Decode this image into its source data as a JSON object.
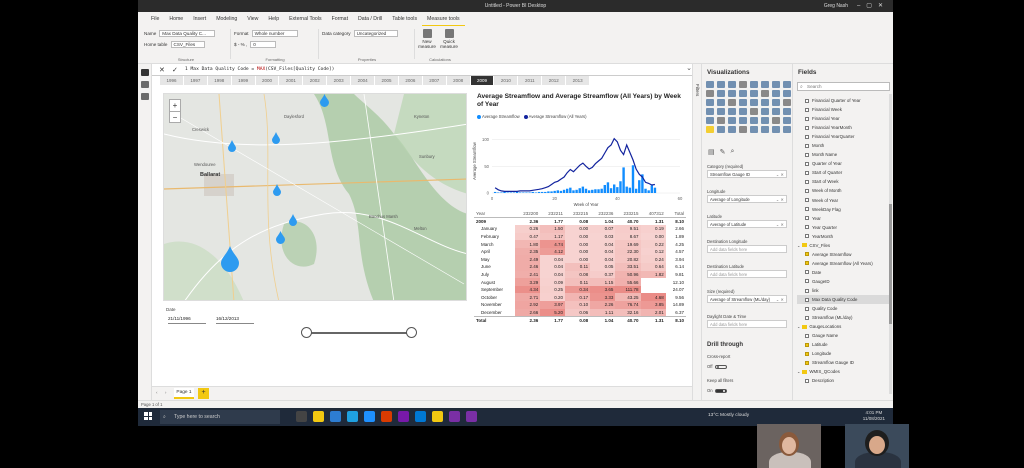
{
  "window": {
    "title": "Untitled - Power BI Desktop",
    "user": "Greg Nash"
  },
  "menu": [
    "File",
    "Home",
    "Insert",
    "Modeling",
    "View",
    "Help",
    "External Tools",
    "Format",
    "Data / Drill",
    "Table tools",
    "Measure tools"
  ],
  "menu_active": "Measure tools",
  "ribbon": {
    "name_label": "Name",
    "name_value": "Max Data Quality C...",
    "home_table_label": "Home table",
    "home_table_value": "CSV_Files",
    "structure_caption": "Structure",
    "format_label": "Format",
    "format_value": "Whole number",
    "format_symbols": "$ - % ,",
    "decimals_value": "0",
    "formatting_caption": "Formatting",
    "data_category_label": "Data category",
    "data_category_value": "Uncategorized",
    "properties_caption": "Properties",
    "new_measure_label": "New measure",
    "quick_measure_label": "Quick measure",
    "calculations_caption": "Calculations"
  },
  "formula": {
    "prefix": "1 Max Data Quality Code = ",
    "func": "MAX",
    "rest": "(CSV_Files[Quality Code])"
  },
  "years": [
    "1996",
    "1997",
    "1998",
    "1999",
    "2000",
    "2001",
    "2002",
    "2003",
    "2004",
    "2005",
    "2006",
    "2007",
    "2008",
    "2009",
    "2010",
    "2011",
    "2012",
    "2013"
  ],
  "year_selected": "2009",
  "map": {
    "labels": [
      {
        "text": "Ballarat",
        "big": true
      },
      {
        "text": "Wendouree"
      },
      {
        "text": "Creswick"
      },
      {
        "text": "Bacchus Marsh"
      },
      {
        "text": "Melton"
      },
      {
        "text": "Sunbury"
      },
      {
        "text": "Daylesford"
      },
      {
        "text": "Kyneton"
      }
    ]
  },
  "date_slicer": {
    "label": "Date",
    "from": "21/11/1996",
    "to": "16/12/2013"
  },
  "chart": {
    "title": "Average Streamflow and Average Streamflow (All Years) by Week of Year",
    "legend": [
      "Average Streamflow",
      "Average Streamflow (All Years)"
    ],
    "ylabel": "Average Streamflow",
    "xlabel": "Week of Year",
    "y_ticks": [
      "100",
      "50",
      "0"
    ],
    "x_ticks": [
      "0",
      "20",
      "40",
      "60"
    ]
  },
  "chart_data": {
    "type": "line",
    "title": "Average Streamflow and Average Streamflow (All Years) by Week of Year",
    "xlabel": "Week of Year",
    "ylabel": "Average Streamflow",
    "xlim": [
      0,
      60
    ],
    "ylim": [
      0,
      120
    ],
    "series": [
      {
        "name": "Average Streamflow",
        "kind": "bar",
        "color": "#118dff",
        "x": [
          1,
          2,
          3,
          4,
          5,
          6,
          7,
          8,
          9,
          10,
          11,
          12,
          13,
          14,
          15,
          16,
          17,
          18,
          19,
          20,
          21,
          22,
          23,
          24,
          25,
          26,
          27,
          28,
          29,
          30,
          31,
          32,
          33,
          34,
          35,
          36,
          37,
          38,
          39,
          40,
          41,
          42,
          43,
          44,
          45,
          46,
          47,
          48,
          49,
          50,
          51,
          52
        ],
        "y": [
          2,
          1,
          1,
          2,
          1,
          1,
          1,
          2,
          1,
          1,
          1,
          1,
          2,
          1,
          2,
          2,
          2,
          3,
          3,
          4,
          5,
          4,
          6,
          8,
          10,
          5,
          6,
          9,
          12,
          8,
          5,
          6,
          7,
          7,
          8,
          15,
          20,
          9,
          16,
          11,
          22,
          48,
          12,
          10,
          52,
          8,
          24,
          35,
          8,
          5,
          14,
          10
        ]
      },
      {
        "name": "Average Streamflow (All Years)",
        "kind": "line",
        "color": "#12239e",
        "x": [
          1,
          2,
          3,
          4,
          5,
          6,
          7,
          8,
          9,
          10,
          11,
          12,
          13,
          14,
          15,
          16,
          17,
          18,
          19,
          20,
          21,
          22,
          23,
          24,
          25,
          26,
          27,
          28,
          29,
          30,
          31,
          32,
          33,
          34,
          35,
          36,
          37,
          38,
          39,
          40,
          41,
          42,
          43,
          44,
          45,
          46,
          47,
          48,
          49,
          50,
          51,
          52
        ],
        "y": [
          10,
          6,
          4,
          3,
          3,
          3,
          3,
          3,
          4,
          4,
          4,
          4,
          5,
          6,
          7,
          8,
          10,
          12,
          16,
          20,
          22,
          26,
          30,
          38,
          44,
          40,
          46,
          52,
          56,
          50,
          45,
          48,
          55,
          60,
          65,
          75,
          85,
          90,
          102,
          96,
          80,
          72,
          90,
          76,
          62,
          45,
          35,
          30,
          20,
          18,
          15,
          16
        ]
      }
    ]
  },
  "matrix": {
    "columns": [
      "Year",
      "232200",
      "232211",
      "232215",
      "232236",
      "233215",
      "407312",
      "Total"
    ],
    "year_row": {
      "label": "2009",
      "values": [
        "2.36",
        "1.77",
        "0.08",
        "1.04",
        "40.70",
        "1.31",
        "8.10"
      ]
    },
    "rows": [
      {
        "label": "January",
        "values": [
          "0.26",
          "1.50",
          "0.00",
          "0.07",
          "9.51",
          "0.19",
          "2.66"
        ]
      },
      {
        "label": "February",
        "values": [
          "0.47",
          "1.17",
          "0.00",
          "0.03",
          "8.67",
          "0.00",
          "1.89"
        ]
      },
      {
        "label": "March",
        "values": [
          "1.80",
          "4.74",
          "0.00",
          "0.04",
          "19.69",
          "0.22",
          "4.25"
        ]
      },
      {
        "label": "April",
        "values": [
          "2.35",
          "4.12",
          "0.00",
          "0.04",
          "22.30",
          "0.12",
          "4.57"
        ]
      },
      {
        "label": "May",
        "values": [
          "2.49",
          "0.04",
          "0.00",
          "0.04",
          "20.82",
          "0.24",
          "3.94"
        ]
      },
      {
        "label": "June",
        "values": [
          "2.46",
          "0.04",
          "0.11",
          "0.05",
          "33.51",
          "0.64",
          "6.14"
        ]
      },
      {
        "label": "July",
        "values": [
          "2.41",
          "0.04",
          "0.08",
          "0.37",
          "50.96",
          "1.82",
          "9.81"
        ]
      },
      {
        "label": "August",
        "values": [
          "3.29",
          "0.09",
          "0.11",
          "1.15",
          "55.66",
          "",
          "12.10"
        ]
      },
      {
        "label": "September",
        "values": [
          "4.34",
          "0.25",
          "0.34",
          "3.65",
          "111.78",
          "",
          "24.07"
        ]
      },
      {
        "label": "October",
        "values": [
          "2.71",
          "0.20",
          "0.17",
          "3.33",
          "43.25",
          "4.68",
          "9.56"
        ]
      },
      {
        "label": "November",
        "values": [
          "2.92",
          "3.97",
          "0.10",
          "2.26",
          "76.74",
          "3.85",
          "14.89"
        ]
      },
      {
        "label": "December",
        "values": [
          "2.66",
          "5.20",
          "0.06",
          "1.11",
          "32.16",
          "2.01",
          "6.37"
        ]
      }
    ],
    "total_row": {
      "label": "Total",
      "values": [
        "2.36",
        "1.77",
        "0.08",
        "1.04",
        "40.70",
        "1.31",
        "8.10"
      ]
    },
    "heat_cols_color": "#e8807a"
  },
  "pages": {
    "tab": "Page 1",
    "status": "Page 1 of 1"
  },
  "filters_label": "Filters",
  "viz": {
    "title": "Visualizations",
    "wells": [
      {
        "label": "Category (required)",
        "value": "Streamflow Gauge ID",
        "empty": false
      },
      {
        "label": "Longitude",
        "value": "Average of Longitude",
        "empty": false
      },
      {
        "label": "Latitude",
        "value": "Average of Latitude",
        "empty": false
      },
      {
        "label": "Destination Longitude",
        "value": "Add data fields here",
        "empty": true
      },
      {
        "label": "Destination Latitude",
        "value": "Add data fields here",
        "empty": true
      },
      {
        "label": "Size (required)",
        "value": "Average of Streamflow (ML/day)",
        "empty": false
      },
      {
        "label": "Daylight Date & Time",
        "value": "Add data fields here",
        "empty": true
      }
    ],
    "drill_title": "Drill through",
    "cross_report": "Cross-report",
    "cross_state": "Off",
    "keep_filters": "Keep all filters",
    "keep_state": "On"
  },
  "fields": {
    "title": "Fields",
    "search_placeholder": "Search",
    "items": [
      {
        "text": "Financial Quarter of Year",
        "type": "field"
      },
      {
        "text": "Financial Week",
        "type": "field"
      },
      {
        "text": "Financial Year",
        "type": "field"
      },
      {
        "text": "Financial YearMonth",
        "type": "field"
      },
      {
        "text": "Financial YearQuarter",
        "type": "field"
      },
      {
        "text": "Month",
        "type": "field"
      },
      {
        "text": "Month Name",
        "type": "field"
      },
      {
        "text": "Quarter of Year",
        "type": "field"
      },
      {
        "text": "Start of Quarter",
        "type": "field"
      },
      {
        "text": "Start of Week",
        "type": "field"
      },
      {
        "text": "Week of Month",
        "type": "field"
      },
      {
        "text": "Week of Year",
        "type": "field"
      },
      {
        "text": "WeekDay Flag",
        "type": "field"
      },
      {
        "text": "Year",
        "type": "field"
      },
      {
        "text": "Year Quarter",
        "type": "field"
      },
      {
        "text": "YearMonth",
        "type": "field"
      },
      {
        "text": "CSV_Files",
        "type": "table"
      },
      {
        "text": "Average Streamflow",
        "type": "field",
        "checked": true
      },
      {
        "text": "Average Streamflow (All Years)",
        "type": "field",
        "checked": true
      },
      {
        "text": "Date",
        "type": "field"
      },
      {
        "text": "GaugeID",
        "type": "field"
      },
      {
        "text": "link",
        "type": "field"
      },
      {
        "text": "Max Data Quality Code",
        "type": "field",
        "selected": true
      },
      {
        "text": "Quality Code",
        "type": "field"
      },
      {
        "text": "Streamflow (ML/day)",
        "type": "field"
      },
      {
        "text": "GaugeLocations",
        "type": "table"
      },
      {
        "text": "Gauge Name",
        "type": "field"
      },
      {
        "text": "Latitude",
        "type": "field",
        "checked": true
      },
      {
        "text": "Longitude",
        "type": "field",
        "checked": true
      },
      {
        "text": "Streamflow Gauge ID",
        "type": "field",
        "checked": true
      },
      {
        "text": "WMIS_QCodes",
        "type": "table"
      },
      {
        "text": "Description",
        "type": "field"
      }
    ]
  },
  "taskbar": {
    "search_placeholder": "Type here to search",
    "weather": "13°C  Mostly cloudy",
    "time": "4:01 PM",
    "date": "11/08/2021",
    "app_colors": [
      "#444",
      "#f2c811",
      "#2d7dd2",
      "#1fa0e0",
      "#1e90ff",
      "#d83b01",
      "#7719aa",
      "#0078d4",
      "#f2c811",
      "#7a2fa5",
      "#7a2fa5"
    ]
  }
}
